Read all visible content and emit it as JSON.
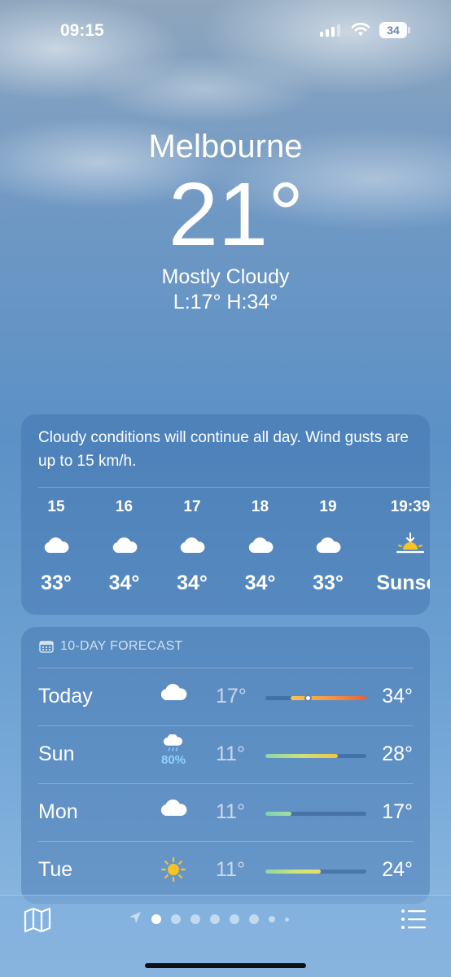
{
  "status_bar": {
    "time": "09:15",
    "battery": "34"
  },
  "current": {
    "city": "Melbourne",
    "temperature": "21°",
    "condition": "Mostly Cloudy",
    "low_high": "L:17° H:34°"
  },
  "hourly": {
    "summary": "Cloudy conditions will continue all day. Wind gusts are up to 15 km/h.",
    "items": [
      {
        "label": "15",
        "icon": "cloud-icon",
        "temp": "33°"
      },
      {
        "label": "16",
        "icon": "cloud-icon",
        "temp": "34°"
      },
      {
        "label": "17",
        "icon": "cloud-icon",
        "temp": "34°"
      },
      {
        "label": "18",
        "icon": "cloud-icon",
        "temp": "34°"
      },
      {
        "label": "19",
        "icon": "cloud-icon",
        "temp": "33°"
      },
      {
        "label": "19:39",
        "icon": "sunset-icon",
        "temp": "Sunset"
      }
    ]
  },
  "forecast": {
    "header": "10-DAY FORECAST",
    "days": [
      {
        "day": "Today",
        "icon": "cloud-icon",
        "precip": "",
        "low": "17°",
        "high": "34°",
        "range_start": 0.25,
        "range_end": 1.0,
        "current_pos": 0.42,
        "gradient": "linear-gradient(90deg,#f2c94c,#f2994a,#e8603c)"
      },
      {
        "day": "Sun",
        "icon": "cloud-rain-icon",
        "precip": "80%",
        "low": "11°",
        "high": "28°",
        "range_start": 0.0,
        "range_end": 0.72,
        "gradient": "linear-gradient(90deg,#8ed6a8,#cbe27a,#f4c542)"
      },
      {
        "day": "Mon",
        "icon": "cloud-icon",
        "precip": "",
        "low": "11°",
        "high": "17°",
        "range_start": 0.0,
        "range_end": 0.26,
        "gradient": "linear-gradient(90deg,#7fd3b0,#a3e0a0)"
      },
      {
        "day": "Tue",
        "icon": "sun-icon",
        "precip": "",
        "low": "11°",
        "high": "24°",
        "range_start": 0.0,
        "range_end": 0.55,
        "gradient": "linear-gradient(90deg,#8ed6a8,#c8e27a,#e6e06a)"
      }
    ]
  },
  "bottom_bar": {
    "page_count": 9,
    "active_page": 1
  }
}
